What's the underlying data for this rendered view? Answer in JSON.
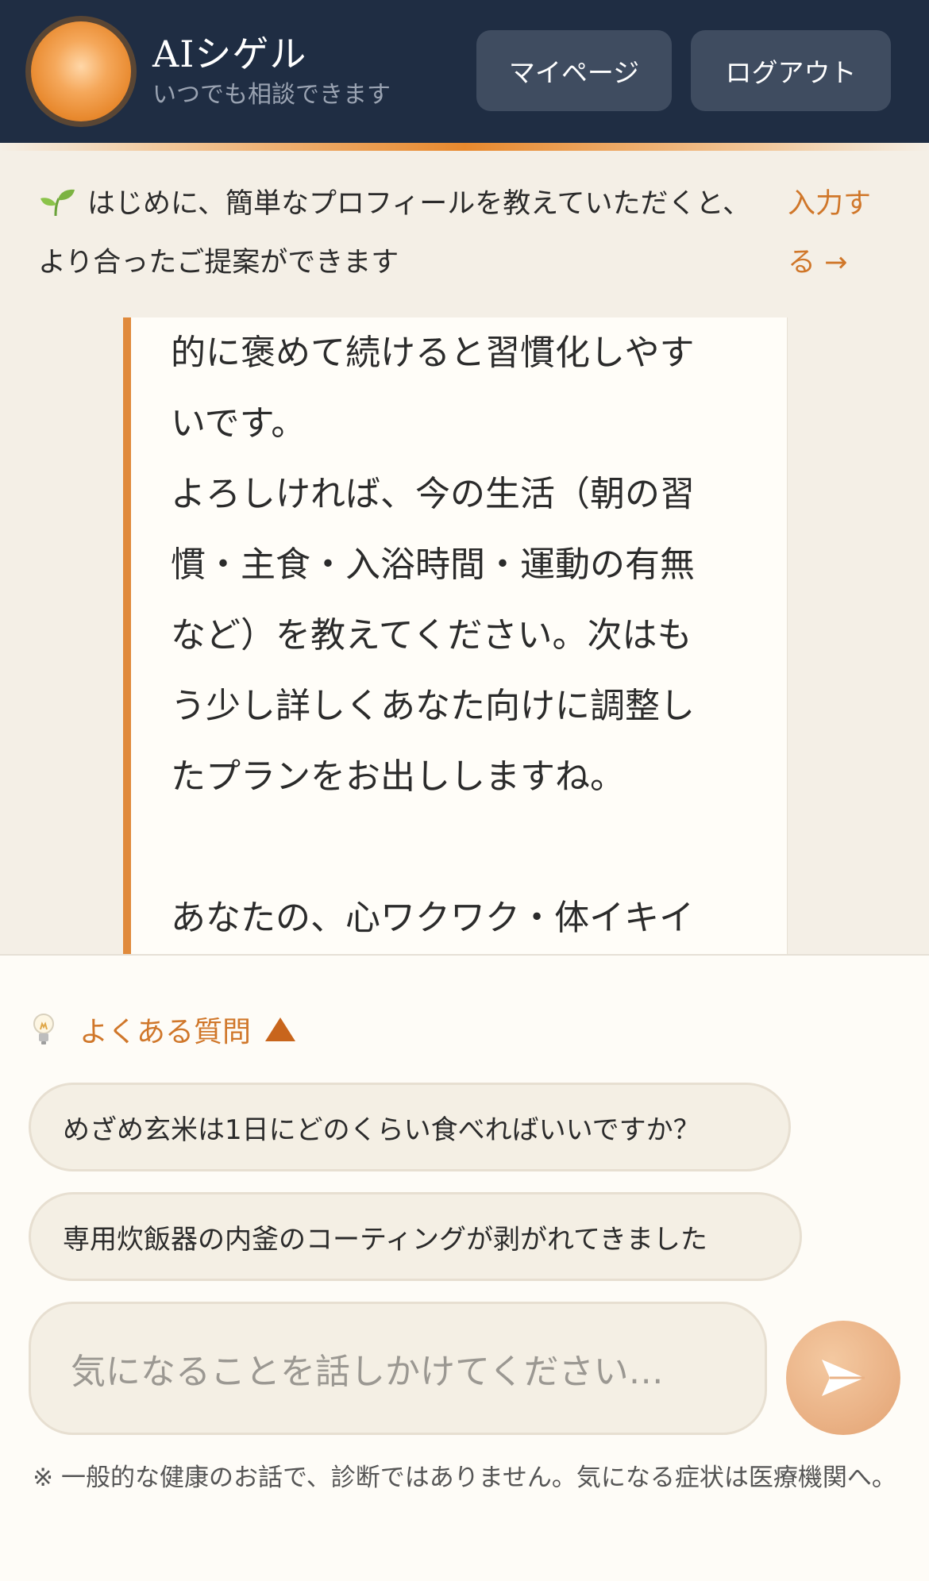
{
  "header": {
    "title": "AIシゲル",
    "subtitle": "いつでも相談できます",
    "mypage_label": "マイページ",
    "logout_label": "ログアウト"
  },
  "banner": {
    "icon": "sprout-icon",
    "text": "はじめに、簡単なプロフィールを教えていただくと、より合ったご提案ができます",
    "link_line1": "入力す",
    "link_line2": "る →"
  },
  "message": {
    "line1": "的に褒めて続けると習慣化しやす",
    "line2": "いです。",
    "line3": "よろしければ、今の生活（朝の習",
    "line4": "慣・主食・入浴時間・運動の有無",
    "line5": "など）を教えてください。次はも",
    "line6": "う少し詳しくあなた向けに調整し",
    "line7": "たプランをお出ししますね。",
    "line8": "あなたの、心ワクワク・体イキイ"
  },
  "faq": {
    "icon": "lightbulb-icon",
    "heading": "よくある質問",
    "items": [
      "めざめ玄米は1日にどのくらい食べればいいですか？",
      "専用炊飯器の内釜のコーティングが剥がれてきました"
    ]
  },
  "composer": {
    "placeholder": "気になることを話しかけてください…",
    "send_icon": "send-icon"
  },
  "disclaimer": "※ 一般的な健康のお話で、診断ではありません。気になる症状は医療機関へ。",
  "colors": {
    "header_bg": "#1f2d43",
    "accent": "#e08a3c",
    "link": "#d0772a",
    "page_bg": "#f4efe6"
  }
}
